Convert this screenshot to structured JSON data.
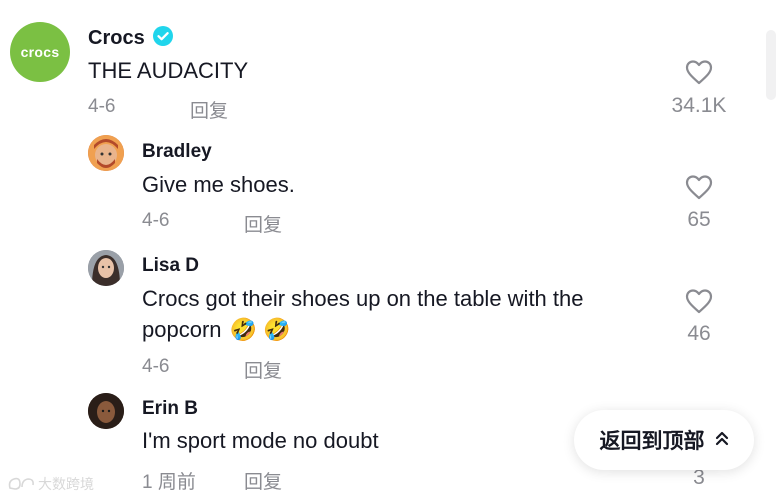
{
  "main_comment": {
    "author": "Crocs",
    "avatar_text": "crocs",
    "verified": true,
    "text": "THE AUDACITY",
    "date": "4-6",
    "reply_label": "回复",
    "likes": "34.1K"
  },
  "replies": [
    {
      "author": "Bradley",
      "text": "Give me shoes.",
      "date": "4-6",
      "reply_label": "回复",
      "likes": "65"
    },
    {
      "author": "Lisa D",
      "text_line1": "Crocs got their shoes up on the table with the",
      "text_line2": "popcorn",
      "emoji": "🤣 🤣",
      "date": "4-6",
      "reply_label": "回复",
      "likes": "46"
    },
    {
      "author": "Erin B",
      "text": "I'm sport mode no doubt",
      "date": "1 周前",
      "reply_label": "回复",
      "likes": "3"
    }
  ],
  "back_to_top": {
    "label": "返回到顶部",
    "icon": "double-chevron-up-icon"
  },
  "watermark": {
    "text": "大数跨境"
  },
  "colors": {
    "crocs_green": "#7bc043",
    "verified_blue": "#20d5ec",
    "meta_gray": "#8a8b91"
  }
}
